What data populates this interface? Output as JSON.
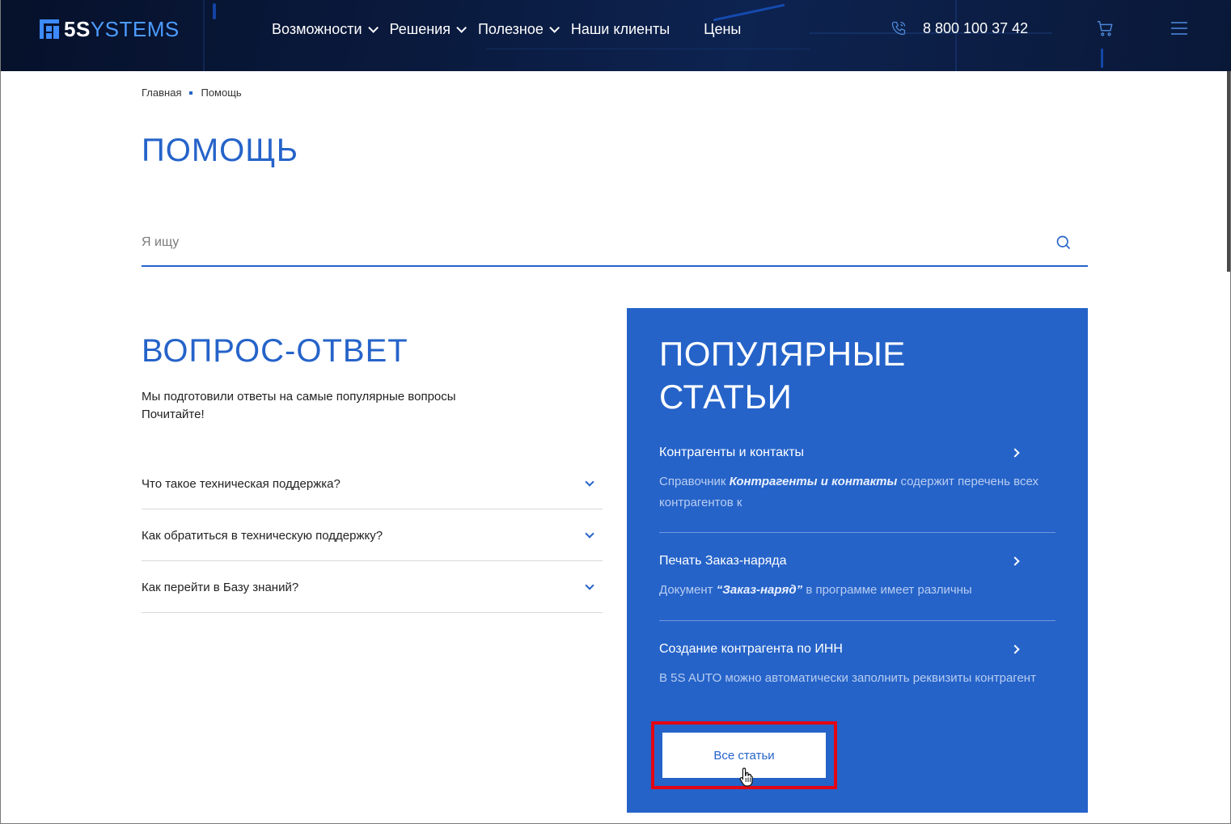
{
  "header": {
    "logo_bold": "5S",
    "logo_rest": "YSTEMS",
    "nav": [
      {
        "label": "Возможности",
        "has_dropdown": true
      },
      {
        "label": "Решения",
        "has_dropdown": true
      },
      {
        "label": "Полезное",
        "has_dropdown": true
      },
      {
        "label": "Наши клиенты",
        "has_dropdown": false
      },
      {
        "label": "Цены",
        "has_dropdown": false
      }
    ],
    "phone": "8 800 100 37 42",
    "icons": [
      "phone-icon",
      "cart-icon",
      "menu-icon"
    ]
  },
  "breadcrumb": {
    "home": "Главная",
    "current": "Помощь"
  },
  "page_title": "ПОМОЩЬ",
  "search": {
    "placeholder": "Я ищу"
  },
  "faq": {
    "title": "ВОПРОС-ОТВЕТ",
    "subtitle_line1": "Мы подготовили ответы на самые популярные вопросы",
    "subtitle_line2": "Почитайте!",
    "items": [
      {
        "question": "Что такое техническая поддержка?"
      },
      {
        "question": "Как обратиться в техническую поддержку?"
      },
      {
        "question": "Как перейти в Базу знаний?"
      }
    ]
  },
  "popular": {
    "title_line1": "ПОПУЛЯРНЫЕ",
    "title_line2": "СТАТЬИ",
    "articles": [
      {
        "title": "Контрагенты и контакты",
        "desc_pre": "Справочник ",
        "desc_bold": "Контрагенты и контакты",
        "desc_post": " содержит перечень всех контрагентов к"
      },
      {
        "title": "Печать Заказ-наряда",
        "desc_pre": "Документ ",
        "desc_bold": "“Заказ-наряд”",
        "desc_post": " в программе имеет различны"
      },
      {
        "title": "Создание контрагента по ИНН",
        "desc_pre": "В 5S AUTO можно автоматически заполнить реквизиты контрагент",
        "desc_bold": "",
        "desc_post": ""
      }
    ],
    "all_button": "Все статьи"
  },
  "colors": {
    "brand_blue": "#2563c9",
    "header_dark": "#06112b",
    "highlight_red": "#e30613"
  }
}
